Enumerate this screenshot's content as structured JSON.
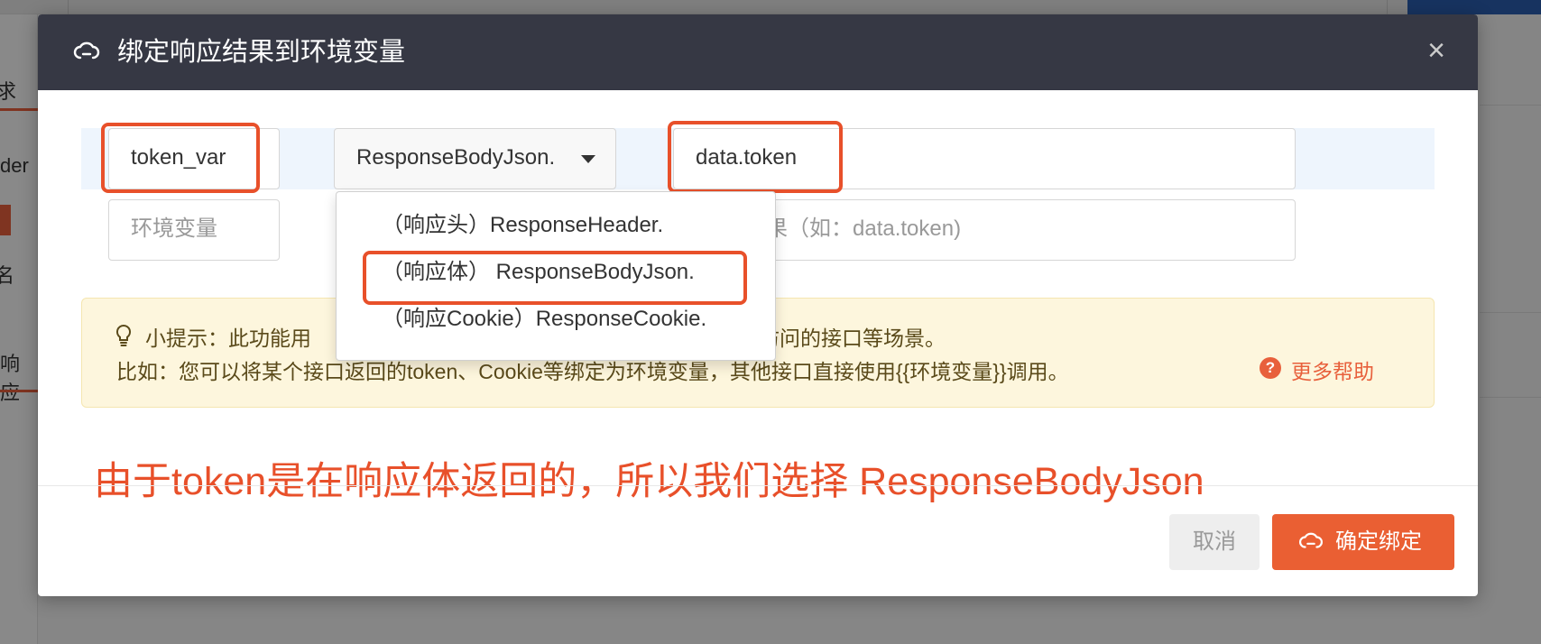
{
  "background": {
    "tabs": [
      "求",
      "der",
      "名",
      "响应"
    ]
  },
  "modal": {
    "title": "绑定响应结果到环境变量",
    "close": "×",
    "rows": [
      {
        "var_name": "token_var",
        "var_placeholder": "",
        "source": "ResponseBodyJson.",
        "path": "data.token"
      },
      {
        "var_name": "",
        "var_placeholder": "环境变量",
        "path_placeholder": "果（如：data.token)"
      }
    ],
    "dropdown_options": [
      "（响应头）ResponseHeader.",
      "（响应体） ResponseBodyJson.",
      "（响应Cookie）ResponseCookie."
    ],
    "tip": {
      "line1_a": "小提示：此功能用",
      "line1_b": "访问的接口等场景。",
      "line2": "比如：您可以将某个接口返回的token、Cookie等绑定为环境变量，其他接口直接使用{{环境变量}}调用。",
      "help_icon": "?",
      "help_link": "更多帮助"
    },
    "annotation": "由于token是在响应体返回的，所以我们选择 ResponseBodyJson",
    "buttons": {
      "cancel": "取消",
      "confirm": "确定绑定"
    }
  },
  "colors": {
    "header_bg": "#363844",
    "accent": "#ea5f33",
    "annotation": "#e8502a",
    "tip_bg": "#fdf6dd"
  },
  "icons": {
    "title_icon": "cloud-link-icon",
    "tip_icon": "lightbulb-icon",
    "help_icon": "question-circle-icon",
    "confirm_icon": "cloud-link-icon"
  }
}
